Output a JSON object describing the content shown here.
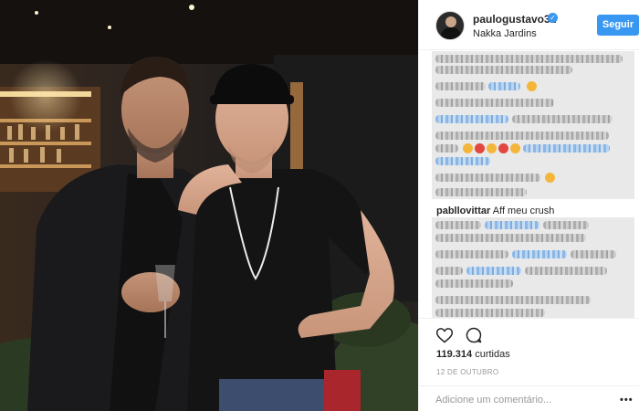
{
  "post": {
    "username": "paulogustavo31",
    "verified": true,
    "location": "Nakka Jardins",
    "follow_label": "Seguir",
    "highlighted_comment": {
      "author": "pabllovittar",
      "text": "Aff meu crush"
    },
    "likes_count": "119.314",
    "likes_suffix": "curtidas",
    "date": "12 DE OUTUBRO",
    "add_comment_placeholder": "Adicione um comentário...",
    "more_label": "•••"
  },
  "icons": {
    "like": "heart-icon",
    "comment": "comment-icon",
    "verified": "verified-badge-icon",
    "more": "more-options-icon"
  },
  "colors": {
    "follow_button": "#3897f0",
    "verified_badge": "#3897f0",
    "secondary_text": "#999999"
  }
}
